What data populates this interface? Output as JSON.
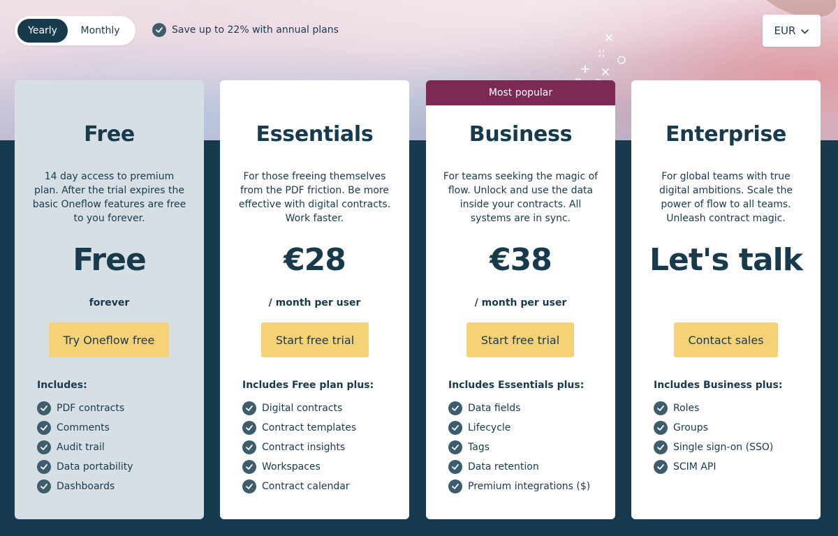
{
  "billing_toggle": {
    "yearly_label": "Yearly",
    "monthly_label": "Monthly",
    "selected": "Yearly"
  },
  "save_note": {
    "text": "Save up to 22% with annual plans",
    "icon": "check-circle-icon"
  },
  "currency": {
    "selected": "EUR",
    "icon": "chevron-down-icon"
  },
  "colors": {
    "navy": "#173a4d",
    "cta_yellow": "#f6d276",
    "ribbon_purple": "#7a2a55",
    "free_card_bg": "#d6dfe3",
    "check_icon": "#3d5d6c"
  },
  "plans": [
    {
      "name": "Free",
      "description": "14 day access to premium plan. After the trial expires the basic Oneflow features are free to you forever.",
      "price": "Free",
      "period": "forever",
      "cta": "Try Oneflow free",
      "includes_title": "Includes:",
      "features": [
        "PDF contracts",
        "Comments",
        "Audit trail",
        "Data portability",
        "Dashboards"
      ]
    },
    {
      "name": "Essentials",
      "description": "For those freeing themselves from the PDF friction. Be more effective with digital contracts. Work faster.",
      "price": "€28",
      "period": "/ month per user",
      "cta": "Start free trial",
      "includes_title": "Includes Free plan plus:",
      "features": [
        "Digital contracts",
        "Contract templates",
        "Contract insights",
        "Workspaces",
        "Contract calendar"
      ]
    },
    {
      "name": "Business",
      "badge": "Most popular",
      "description": "For teams seeking the magic of flow. Unlock and use the data inside your contracts. All systems are in sync.",
      "price": "€38",
      "period": "/ month per user",
      "cta": "Start free trial",
      "includes_title": "Includes Essentials plus:",
      "features": [
        "Data fields",
        "Lifecycle",
        "Tags",
        "Data retention",
        "Premium integrations ($)"
      ]
    },
    {
      "name": "Enterprise",
      "description": "For global teams with true digital ambitions. Scale the power of flow to all teams. Unleash contract magic.",
      "price": "Let's talk",
      "period": "",
      "cta": "Contact sales",
      "includes_title": "Includes Business plus:",
      "features": [
        "Roles",
        "Groups",
        "Single sign-on (SSO)",
        "SCIM API"
      ]
    }
  ]
}
